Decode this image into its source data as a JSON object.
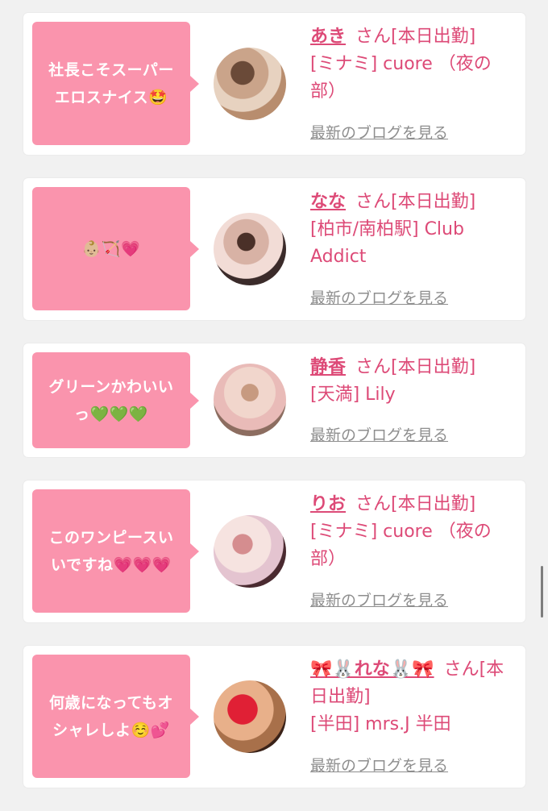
{
  "cards": [
    {
      "comment": "社長こそスーパー\nエロスナイス🤩",
      "name": "あき",
      "san": "さん[本日出勤]",
      "shop": "[ミナミ] cuore （夜の部）",
      "blog": "最新のブログを見る"
    },
    {
      "comment": "👶🏼🏹💗",
      "name": "なな",
      "san": "さん[本日出勤]",
      "shop": "[柏市/南柏駅] Club Addict",
      "blog": "最新のブログを見る"
    },
    {
      "comment": "グリーンかわいい\nっ💚💚💚",
      "name": "静香",
      "san": "さん[本日出勤]",
      "shop": "[天満] Lily",
      "blog": "最新のブログを見る"
    },
    {
      "comment": "このワンピースい\nいですね💗💗💗",
      "name": "りお",
      "san": "さん[本日出勤]",
      "shop": "[ミナミ] cuore （夜の部）",
      "blog": "最新のブログを見る"
    },
    {
      "comment": "何歳になってもオ\nシャレしよ☺️💕",
      "name": "🎀🐰れな🐰🎀",
      "san": "さん[本日出勤]",
      "shop": "[半田] mrs.J 半田",
      "blog": "最新のブログを見る"
    }
  ],
  "colors": {
    "accent": "#dd4a77",
    "bubble": "#fa94ad",
    "link": "#8e8e8e",
    "background": "#f1f1f1"
  }
}
